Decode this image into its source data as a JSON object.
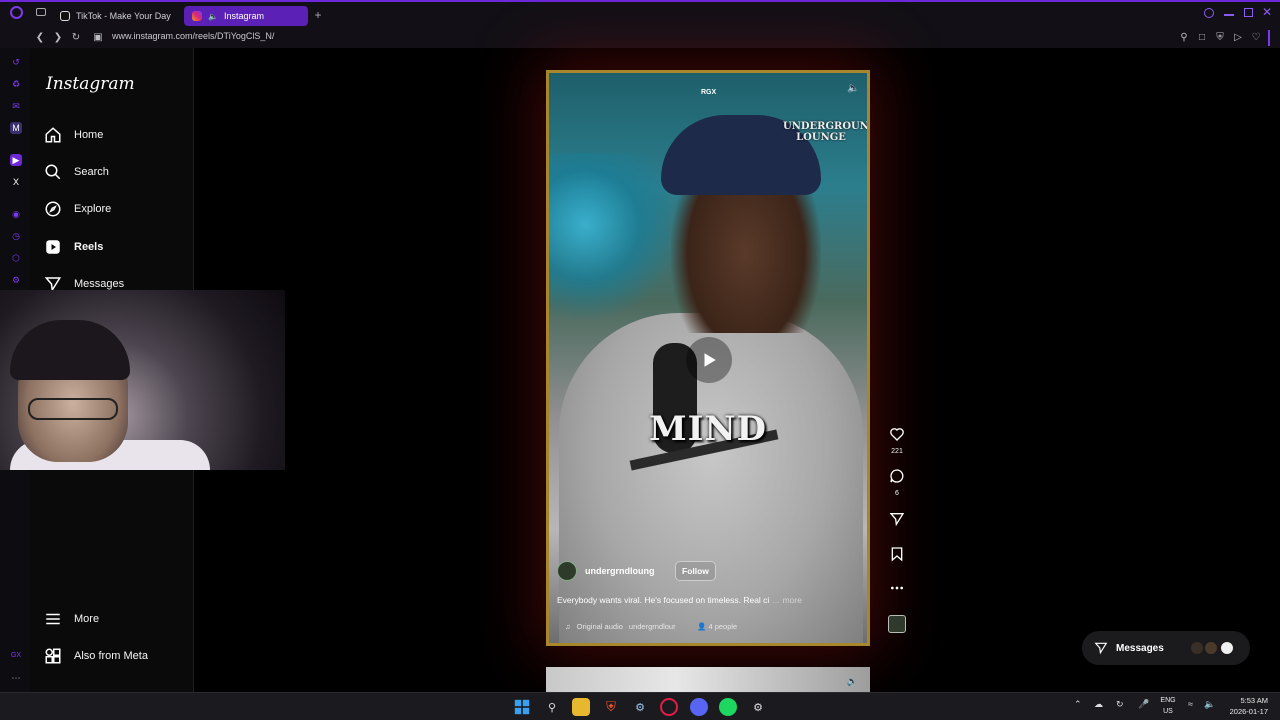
{
  "browser": {
    "tabs": [
      {
        "label": "TikTok - Make Your Day",
        "active": false
      },
      {
        "label": "Instagram",
        "active": true
      }
    ],
    "new_tab_label": "+",
    "url": "www.instagram.com/reels/DTiYogClS_N/"
  },
  "instagram": {
    "logo": "Instagram",
    "nav": [
      {
        "label": "Home",
        "icon": "home-icon"
      },
      {
        "label": "Search",
        "icon": "search-icon"
      },
      {
        "label": "Explore",
        "icon": "compass-icon"
      },
      {
        "label": "Reels",
        "icon": "reels-icon",
        "active": true
      },
      {
        "label": "Messages",
        "icon": "messages-icon"
      }
    ],
    "bottom_nav": [
      {
        "label": "More",
        "icon": "menu-icon"
      },
      {
        "label": "Also from Meta",
        "icon": "meta-grid-icon"
      }
    ]
  },
  "reel": {
    "watermark": "RGX",
    "channel_logo": "UNDERGROUND LOUNGE",
    "overlay_word": "MIND",
    "author": "undergrndloung",
    "follow_label": "Follow",
    "caption": "Everybody wants viral. He's focused on timeless. Real ci",
    "caption_more": "… more",
    "audio": {
      "label": "Original audio",
      "source": "undergrndlour"
    },
    "people_label": "4 people",
    "actions": {
      "likes": "221",
      "comments": "6"
    }
  },
  "messages_pill": {
    "label": "Messages"
  },
  "taskbar": {
    "language": "ENG",
    "region": "US",
    "time": "5:53 AM",
    "date": "2026-01-17"
  },
  "colors": {
    "accent": "#6d28d9",
    "reel_border": "#a8862b",
    "glow": "#b41414"
  }
}
